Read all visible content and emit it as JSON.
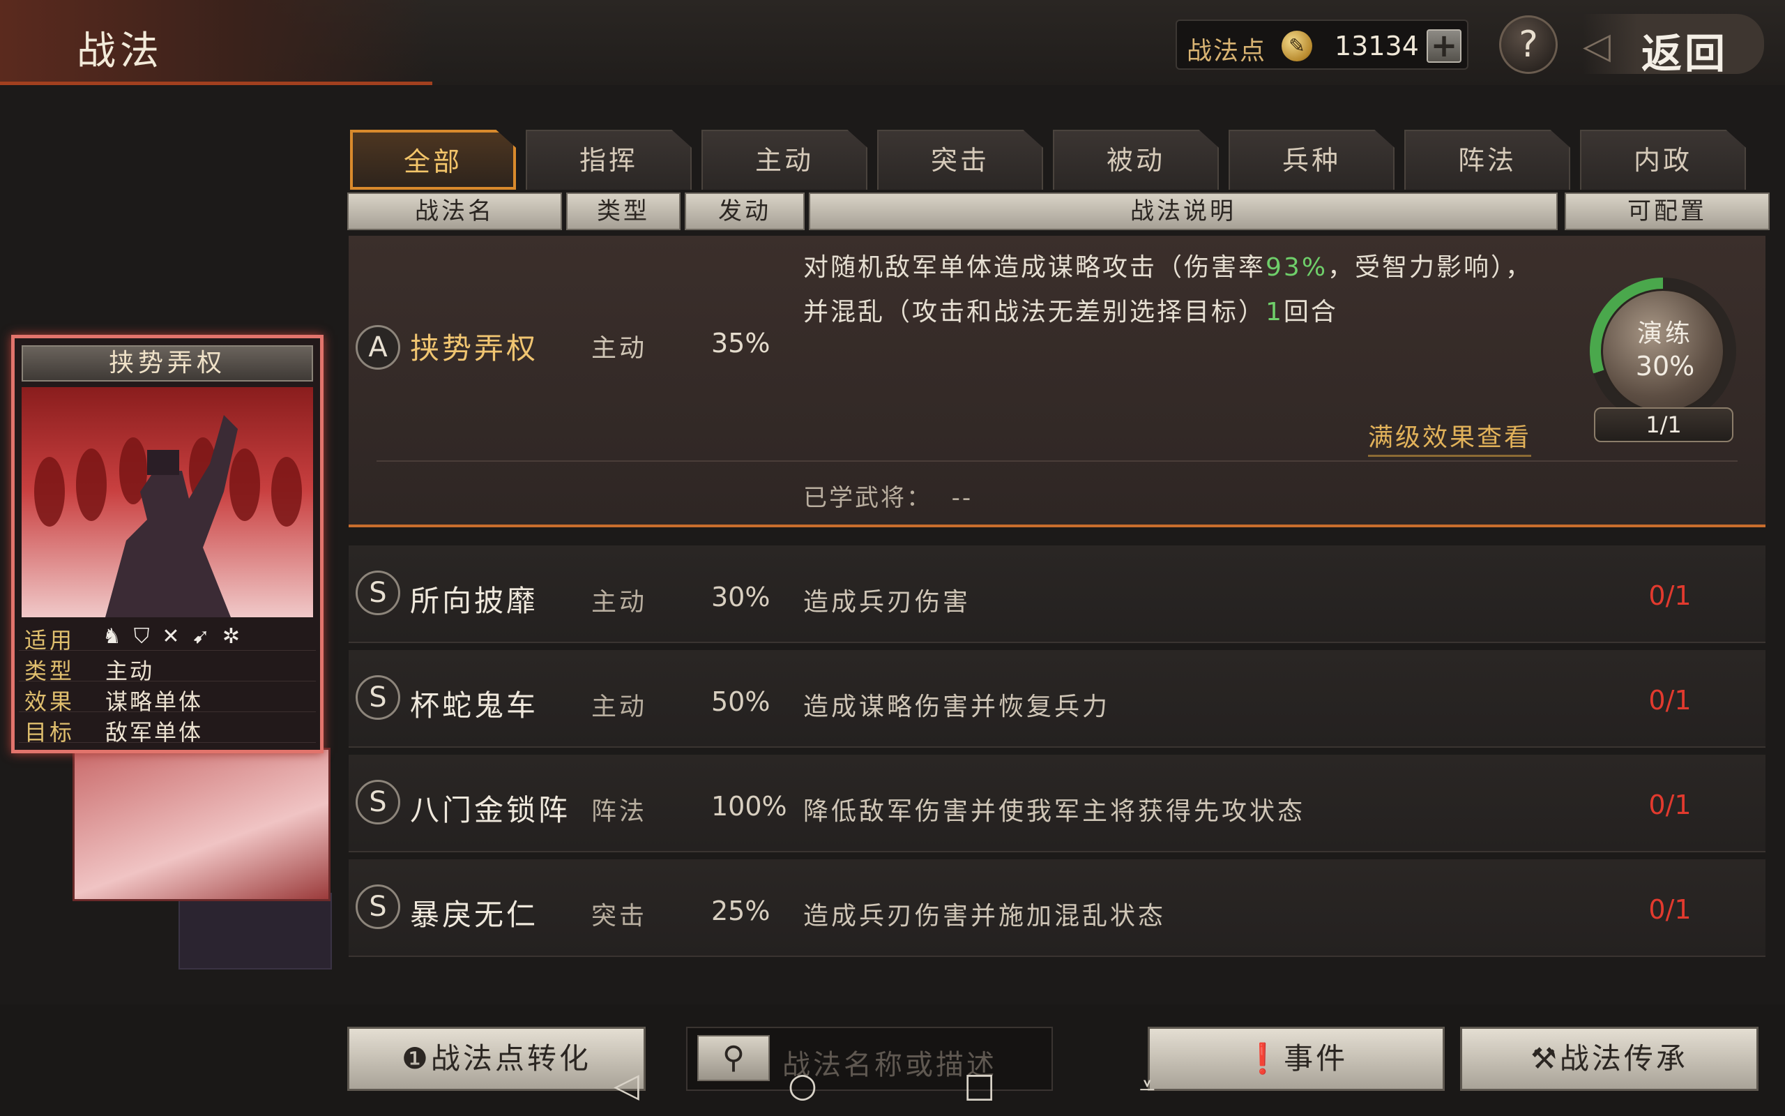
{
  "header": {
    "title": "战法",
    "points_label": "战法点",
    "points_value": "13134",
    "plus": "+",
    "help": "?",
    "back_label": "返回",
    "coin_glyph": "✎"
  },
  "tabs": [
    "全部",
    "指挥",
    "主动",
    "突击",
    "被动",
    "兵种",
    "阵法",
    "内政"
  ],
  "columns": {
    "name": "战法名",
    "type": "类型",
    "trigger": "发动",
    "desc": "战法说明",
    "config": "可配置"
  },
  "expanded": {
    "grade": "A",
    "name": "挟势弄权",
    "type": "主动",
    "rate": "35%",
    "desc_part1": "对随机敌军单体造成谋略攻击（伤害率",
    "desc_green1": "93%",
    "desc_part2": "，受智力影响），并混乱（攻击和战法无差别选择目标）",
    "desc_green2": "1",
    "desc_part3": "回合",
    "full_effect": "满级效果查看",
    "learned_label": "已学武将：",
    "learned_value": "--",
    "drill_label": "演练",
    "drill_pct": "30%",
    "drill_count": "1/1"
  },
  "rows": [
    {
      "grade": "S",
      "name": "所向披靡",
      "type": "主动",
      "rate": "30%",
      "desc": "造成兵刃伤害",
      "count": "0/1"
    },
    {
      "grade": "S",
      "name": "杯蛇鬼车",
      "type": "主动",
      "rate": "50%",
      "desc": "造成谋略伤害并恢复兵力",
      "count": "0/1"
    },
    {
      "grade": "S",
      "name": "八门金锁阵",
      "type": "阵法",
      "rate": "100%",
      "desc": "降低敌军伤害并使我军主将获得先攻状态",
      "count": "0/1"
    },
    {
      "grade": "S",
      "name": "暴戾无仁",
      "type": "突击",
      "rate": "25%",
      "desc": "造成兵刃伤害并施加混乱状态",
      "count": "0/1"
    }
  ],
  "card": {
    "title": "挟势弄权",
    "applies_label": "适用",
    "type_label": "类型",
    "type_value": "主动",
    "effect_label": "效果",
    "effect_value": "谋略单体",
    "target_label": "目标",
    "target_value": "敌军单体",
    "troop_icons": [
      "cavalry-icon",
      "shield-icon",
      "crossed-bows-icon",
      "spear-icon",
      "wheel-icon"
    ]
  },
  "bottom": {
    "convert_label": "战法点转化",
    "search_placeholder": "战法名称或描述",
    "event_label": "事件",
    "inherit_label": "战法传承"
  },
  "colors": {
    "accent": "#d98a2c",
    "gold": "#f0c571",
    "green": "#6fcf6a",
    "red": "#e23a2e"
  }
}
